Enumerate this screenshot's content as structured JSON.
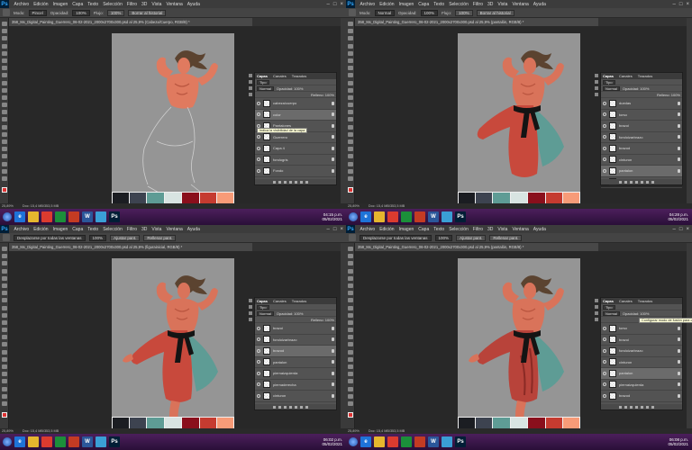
{
  "menu": [
    "Archivo",
    "Edición",
    "Imagen",
    "Capa",
    "Texto",
    "Selección",
    "Filtro",
    "3D",
    "Vista",
    "Ventana",
    "Ayuda"
  ],
  "app_icon": "Ps",
  "icons": {
    "toolbar": "tool-icons",
    "eye": "eye-icon",
    "lock": "lock-icon",
    "start": "windows-start-icon"
  },
  "palette_colors": [
    "#1b1d22",
    "#3d4350",
    "#5e9c95",
    "#d8e4e2",
    "#8a0f1c",
    "#c53b30",
    "#f79b78"
  ],
  "taskbar_apps": [
    {
      "label": "e",
      "color": "#1e73d8"
    },
    {
      "label": "",
      "color": "#e6b62e"
    },
    {
      "label": "",
      "color": "#dc3b2f"
    },
    {
      "label": "",
      "color": "#1b8f3a"
    },
    {
      "label": "",
      "color": "#c43b23"
    },
    {
      "label": "W",
      "color": "#2b579a"
    },
    {
      "label": "",
      "color": "#3a9fd6"
    },
    {
      "label": "Ps",
      "color": "#001e36"
    }
  ],
  "quadrants": [
    {
      "options": {
        "mode_label": "Modo:",
        "mode": "Pincel",
        "opacity_label": "Opacidad:",
        "opacity": "100%",
        "flow_label": "Flujo:",
        "flow": "100%",
        "extra": "Borrar al historial"
      },
      "doc_title": "358_Mx_Digital_Painting_Guerrero_06-02-2021_2000x2700x300.psd al 25,9% (Cabeza/Cuerpo, RGB/8) *",
      "status": [
        "25,89%",
        "Doc: 15,4 MB/353,5 MB"
      ],
      "clock": {
        "time": "04:15 p.m.",
        "date": "05/02/2021"
      },
      "stage": "sketch",
      "panel": {
        "tabs": [
          "Capas",
          "Canales",
          "Trazados"
        ],
        "filter": "Tipo",
        "blend": "Normal",
        "opacity": "Opacidad: 100%",
        "fill": "Relleno: 100%",
        "tooltip": "Indica la visibilidad de la capa",
        "selected": 1,
        "layers": [
          "cabeza/cuerpo",
          "color",
          "Pantalones",
          "Guerrero",
          "Capa 4",
          "fondogris",
          "Fondo"
        ]
      }
    },
    {
      "options": {
        "mode_label": "Modo:",
        "mode": "Normal",
        "opacity_label": "Opacidad:",
        "opacity": "100%",
        "flow_label": "Flujo:",
        "flow": "100%",
        "extra": "Borrar al historial"
      },
      "doc_title": "358_Mx_Digital_Painting_Guerrero_06-02-2021_2000x2700x300.psd al 25,9% (pantalón, RGB/8) *",
      "status": [
        "25,89%",
        "Doc: 15,4 MB/353,5 MB"
      ],
      "clock": {
        "time": "04:28 p.m.",
        "date": "05/02/2021"
      },
      "stage": "pants",
      "panel": {
        "tabs": [
          "Capas",
          "Canales",
          "Trazados"
        ],
        "filter": "Tipo",
        "blend": "Normal",
        "opacity": "Opacidad: 100%",
        "fill": "Relleno: 100%",
        "tooltip": "",
        "selected": 6,
        "layers": [
          "duedas",
          "torso",
          "brazoi",
          "fondoizarbrazo",
          "brazod",
          "cinturon",
          "pantalon",
          "cinturon copia"
        ]
      }
    },
    {
      "options": {
        "mode_label": "",
        "mode": "Desplazarse por todas las ventanas",
        "opacity_label": "",
        "opacity": "100%",
        "flow_label": "",
        "flow": "Ajustar pant.",
        "extra": "Rellenar pant."
      },
      "doc_title": "358_Mx_Digital_Painting_Guerrero_06-02-2021_2000x2700x300.psd al 25,9% (figurainicial, RGB/8) *",
      "status": [
        "25,89%",
        "Doc: 15,4 MB/353,5 MB"
      ],
      "clock": {
        "time": "06:02 p.m.",
        "date": "05/02/2021"
      },
      "stage": "detail",
      "panel": {
        "tabs": [
          "Capas",
          "Canales",
          "Trazados"
        ],
        "filter": "Tipo",
        "blend": "Normal",
        "opacity": "Opacidad: 100%",
        "fill": "Relleno: 100%",
        "tooltip": "",
        "selected": 2,
        "layers": [
          "brazoi",
          "fondoizarbrazo",
          "brazod",
          "pantalon",
          "piernaizquierda",
          "piernaderecha",
          "cinturon"
        ]
      }
    },
    {
      "options": {
        "mode_label": "",
        "mode": "Desplazarse por todas las ventanas",
        "opacity_label": "",
        "opacity": "100%",
        "flow_label": "",
        "flow": "Ajustar pant.",
        "extra": "Rellenar pant."
      },
      "doc_title": "358_Mx_Digital_Painting_Guerrero_06-02-2021_2000x2700x300.psd al 25,9% (pantalón, RGB/8) *",
      "status": [
        "25,89%",
        "Doc: 15,4 MB/353,5 MB"
      ],
      "clock": {
        "time": "06:08 p.m.",
        "date": "05/02/2021"
      },
      "stage": "shaded",
      "panel": {
        "tabs": [
          "Capas",
          "Canales",
          "Trazados"
        ],
        "filter": "Tipo",
        "blend": "Normal",
        "opacity": "Opacidad: 100%",
        "fill": "Relleno: 100%",
        "tooltip": "Configurar modo de fusión para capa",
        "selected": 4,
        "layers": [
          "torso",
          "brazoi",
          "fondoizarbrazo",
          "cinturon",
          "pantalon",
          "piernaizquierda",
          "brazod"
        ]
      }
    }
  ]
}
